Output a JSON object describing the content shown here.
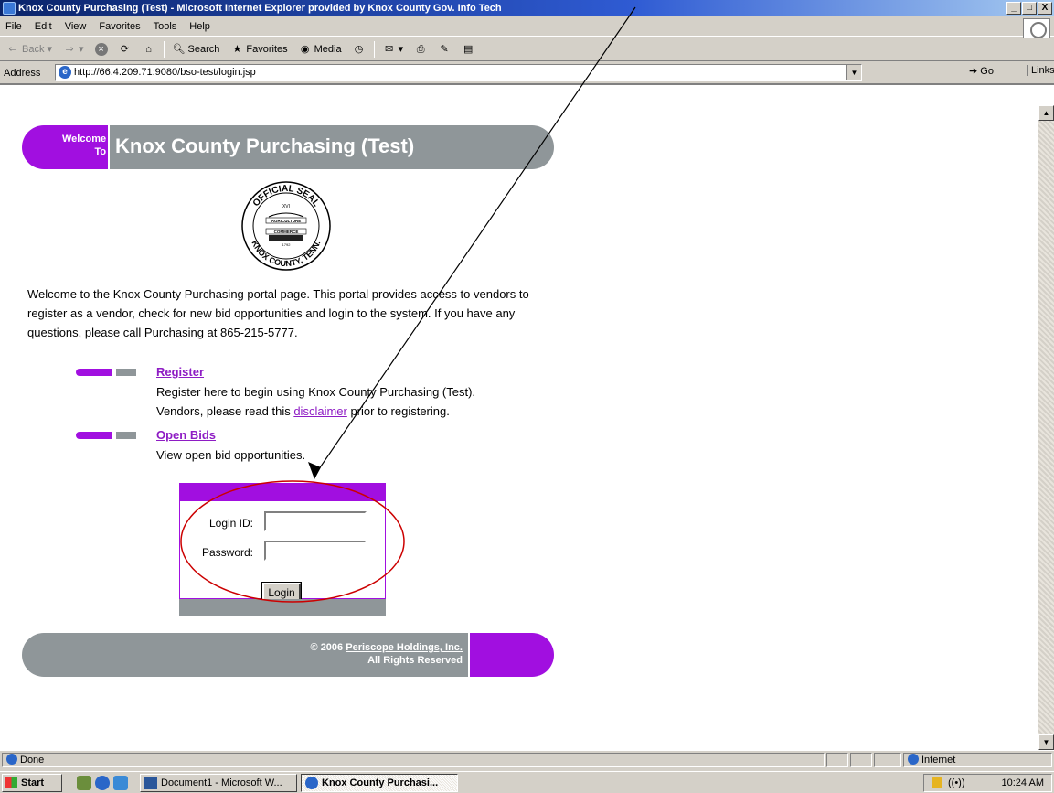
{
  "window": {
    "title": "Knox County Purchasing (Test) - Microsoft Internet Explorer provided by Knox County Gov. Info Tech",
    "min": "_",
    "max": "□",
    "close": "X"
  },
  "menu": [
    "File",
    "Edit",
    "View",
    "Favorites",
    "Tools",
    "Help"
  ],
  "toolbar": {
    "back": "Back",
    "search": "Search",
    "favorites": "Favorites",
    "media": "Media"
  },
  "address": {
    "label": "Address",
    "url": "http://66.4.209.71:9080/bso-test/login.jsp",
    "go": "Go",
    "links": "Links"
  },
  "page": {
    "welcome_line1": "Welcome",
    "welcome_line2": "To",
    "title": "Knox County Purchasing (Test)",
    "seal_text_top": "OFFICIAL SEAL",
    "seal_text_bottom": "KNOX COUNTY, TENN.",
    "seal_inner": [
      "XVI",
      "AGRICULTURE",
      "COMMERCE",
      "1792"
    ],
    "intro": "Welcome to the Knox County Purchasing portal page. This portal provides access to vendors to register as a vendor, check for new bid opportunities and login to the system. If you have any questions, please call Purchasing at 865-215-5777.",
    "register": {
      "title": "Register",
      "desc1": "Register here to begin using Knox County Purchasing (Test).",
      "desc2_pre": "Vendors, please read this ",
      "desc2_link": "disclaimer",
      "desc2_post": " prior to registering."
    },
    "open_bids": {
      "title": "Open Bids",
      "desc": "View open bid opportunities."
    },
    "login": {
      "login_id_label": "Login ID:",
      "login_id_value": "",
      "password_label": "Password:",
      "password_value": "",
      "button": "Login"
    },
    "footer": {
      "copy_prefix": "© 2006 ",
      "company": "Periscope Holdings, Inc.",
      "rights": "All Rights Reserved"
    }
  },
  "status": {
    "text": "Done",
    "zone": "Internet"
  },
  "taskbar": {
    "start": "Start",
    "tasks": [
      {
        "label": "Document1 - Microsoft W...",
        "active": false
      },
      {
        "label": "Knox County Purchasi...",
        "active": true
      }
    ],
    "clock": "10:24 AM"
  },
  "colors": {
    "purple": "#a10fe0",
    "gray": "#8f9699",
    "link": "#8e1cc4",
    "annotation": "#cc0000"
  }
}
